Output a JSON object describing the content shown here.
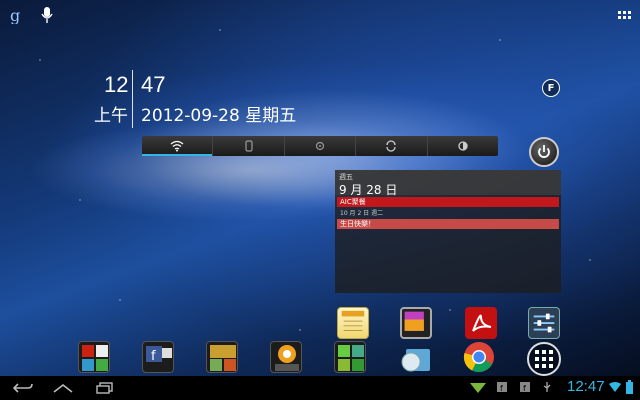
{
  "clock": {
    "hour": "12",
    "minute": "47",
    "ampm": "上午",
    "date": "2012-09-28 星期五"
  },
  "calendar": {
    "weekday": "週五",
    "day": "9 月 28 日",
    "events": [
      {
        "title": "AIC聚餐",
        "color": "#c0181b"
      },
      {
        "title": "10 月 2 日 週二",
        "color": ""
      },
      {
        "title": "生日快樂！",
        "color": "#c64a46"
      }
    ]
  },
  "power_control": {
    "items": [
      "wifi-icon",
      "bluetooth-icon",
      "gps-icon",
      "sync-icon",
      "brightness-icon"
    ]
  },
  "circle_button": {
    "label": "F"
  },
  "status_bar": {
    "time": "12:47"
  },
  "colors": {
    "accent": "#33b5e5",
    "event_red": "#c0181b"
  }
}
